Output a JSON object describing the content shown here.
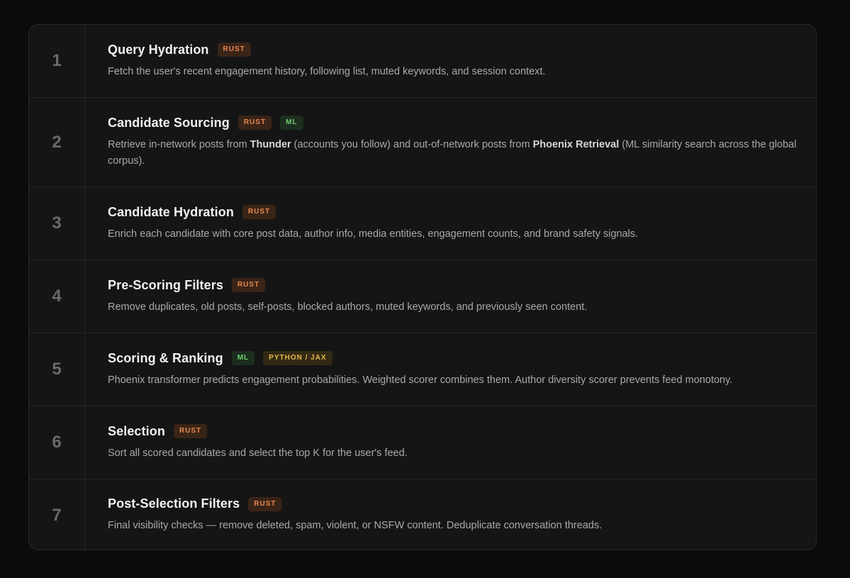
{
  "steps": [
    {
      "number": "1",
      "title": "Query Hydration",
      "badges": [
        {
          "label": "RUST",
          "kind": "rust"
        }
      ],
      "description": [
        {
          "text": "Fetch the user's recent engagement history, following list, muted keywords, and session context."
        }
      ]
    },
    {
      "number": "2",
      "title": "Candidate Sourcing",
      "badges": [
        {
          "label": "RUST",
          "kind": "rust"
        },
        {
          "label": "ML",
          "kind": "ml"
        }
      ],
      "description": [
        {
          "text": "Retrieve in-network posts from "
        },
        {
          "text": "Thunder",
          "bold": true
        },
        {
          "text": " (accounts you follow) and out-of-network posts from "
        },
        {
          "text": "Phoenix Retrieval",
          "bold": true
        },
        {
          "text": " (ML similarity search across the global corpus)."
        }
      ]
    },
    {
      "number": "3",
      "title": "Candidate Hydration",
      "badges": [
        {
          "label": "RUST",
          "kind": "rust"
        }
      ],
      "description": [
        {
          "text": "Enrich each candidate with core post data, author info, media entities, engagement counts, and brand safety signals."
        }
      ]
    },
    {
      "number": "4",
      "title": "Pre-Scoring Filters",
      "badges": [
        {
          "label": "RUST",
          "kind": "rust"
        }
      ],
      "description": [
        {
          "text": "Remove duplicates, old posts, self-posts, blocked authors, muted keywords, and previously seen content."
        }
      ]
    },
    {
      "number": "5",
      "title": "Scoring & Ranking",
      "badges": [
        {
          "label": "ML",
          "kind": "ml"
        },
        {
          "label": "PYTHON / JAX",
          "kind": "py"
        }
      ],
      "description": [
        {
          "text": "Phoenix transformer predicts engagement probabilities. Weighted scorer combines them. Author diversity scorer prevents feed monotony."
        }
      ]
    },
    {
      "number": "6",
      "title": "Selection",
      "badges": [
        {
          "label": "RUST",
          "kind": "rust"
        }
      ],
      "description": [
        {
          "text": "Sort all scored candidates and select the top K for the user's feed."
        }
      ]
    },
    {
      "number": "7",
      "title": "Post-Selection Filters",
      "badges": [
        {
          "label": "RUST",
          "kind": "rust"
        }
      ],
      "description": [
        {
          "text": "Final visibility checks — remove deleted, spam, violent, or NSFW content. Deduplicate conversation threads."
        }
      ]
    }
  ],
  "colors": {
    "rust_badge_bg": "#3a2418",
    "rust_badge_text": "#e8894e",
    "ml_badge_bg": "#1d2e1e",
    "ml_badge_text": "#6fcf73",
    "python_badge_bg": "#332a14",
    "python_badge_text": "#e6b84a"
  }
}
